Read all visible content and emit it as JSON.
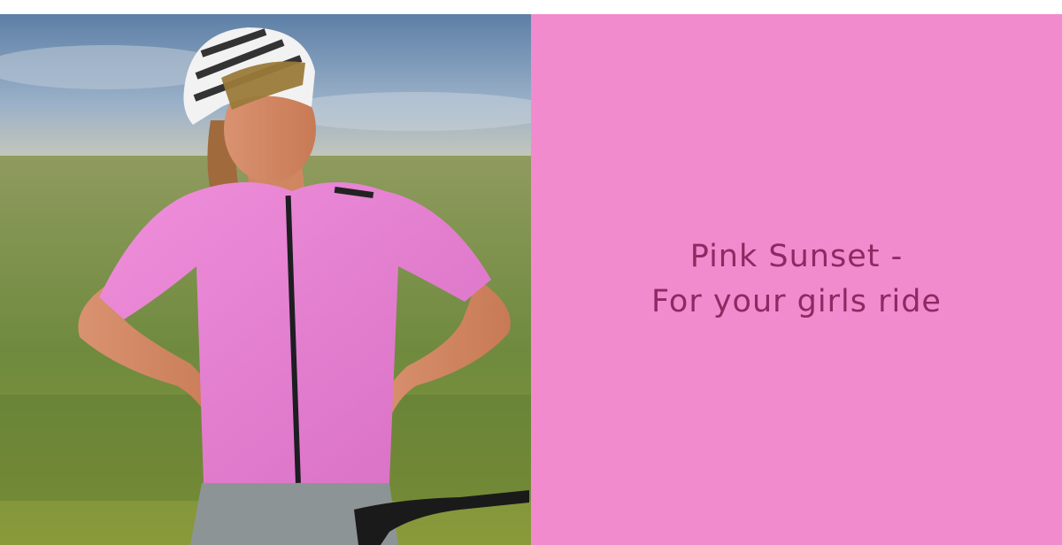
{
  "photo": {
    "alt": "Cyclist in a pink jersey and white helmet standing with hands on hips in a field"
  },
  "promo": {
    "line1": "Pink Sunset -",
    "line2": "For your girls ride"
  },
  "colors": {
    "panel_background": "#f28bcd",
    "headline_text": "#8c2a63",
    "jersey": "#e87fd0"
  }
}
